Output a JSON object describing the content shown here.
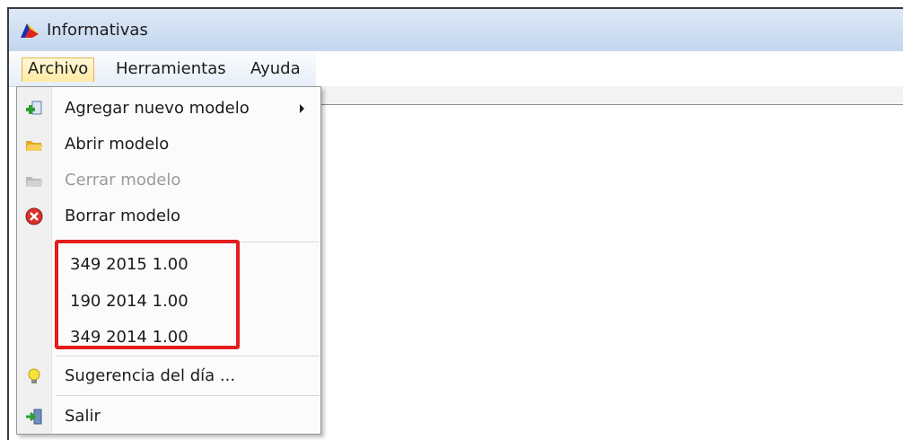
{
  "window": {
    "title": "Informativas"
  },
  "menubar": {
    "items": [
      {
        "label": "Archivo",
        "active": true
      },
      {
        "label": "Herramientas"
      },
      {
        "label": "Ayuda"
      }
    ]
  },
  "dropdown": {
    "items": [
      {
        "label": "Agregar nuevo modelo",
        "icon": "add-model-icon",
        "submenu": true
      },
      {
        "label": "Abrir modelo",
        "icon": "open-folder-icon"
      },
      {
        "label": "Cerrar modelo",
        "icon": "close-folder-icon",
        "disabled": true
      },
      {
        "label": "Borrar modelo",
        "icon": "delete-icon"
      }
    ],
    "recent": [
      "349 2015 1.00",
      "190 2014 1.00",
      "349 2014 1.00"
    ],
    "bottom": [
      {
        "label": "Sugerencia del día ...",
        "icon": "lightbulb-icon"
      },
      {
        "label": "Salir",
        "icon": "exit-icon"
      }
    ]
  },
  "colors": {
    "highlight": "#e41e1e",
    "menu_active": "#ffe9a4"
  }
}
